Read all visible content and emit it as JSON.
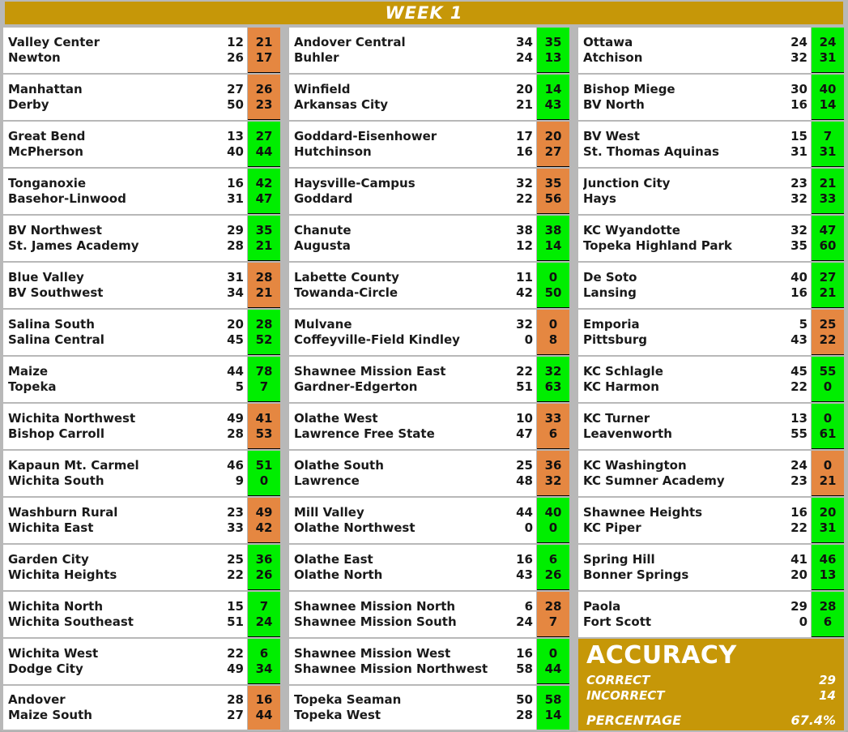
{
  "header": {
    "title": "WEEK 1"
  },
  "colors": {
    "header_gold": "#c69708",
    "correct_green": "#00ee00",
    "incorrect_orange": "#e58741",
    "page_background": "#b8b8b8",
    "row_background": "#ffffff"
  },
  "columns": [
    {
      "id": "column-1",
      "games": [
        {
          "away": "Valley Center",
          "away_score": "12",
          "home": "Newton",
          "home_score": "26",
          "pred_away": "21",
          "pred_home": "17",
          "result": "incorrect"
        },
        {
          "away": "Manhattan",
          "away_score": "27",
          "home": "Derby",
          "home_score": "50",
          "pred_away": "26",
          "pred_home": "23",
          "result": "incorrect"
        },
        {
          "away": "Great Bend",
          "away_score": "13",
          "home": "McPherson",
          "home_score": "40",
          "pred_away": "27",
          "pred_home": "44",
          "result": "correct"
        },
        {
          "away": "Tonganoxie",
          "away_score": "16",
          "home": "Basehor-Linwood",
          "home_score": "31",
          "pred_away": "42",
          "pred_home": "47",
          "result": "correct"
        },
        {
          "away": "BV Northwest",
          "away_score": "29",
          "home": "St. James Academy",
          "home_score": "28",
          "pred_away": "35",
          "pred_home": "21",
          "result": "correct"
        },
        {
          "away": "Blue Valley",
          "away_score": "31",
          "home": "BV Southwest",
          "home_score": "34",
          "pred_away": "28",
          "pred_home": "21",
          "result": "incorrect"
        },
        {
          "away": "Salina South",
          "away_score": "20",
          "home": "Salina Central",
          "home_score": "45",
          "pred_away": "28",
          "pred_home": "52",
          "result": "correct"
        },
        {
          "away": "Maize",
          "away_score": "44",
          "home": "Topeka",
          "home_score": "5",
          "pred_away": "78",
          "pred_home": "7",
          "result": "correct"
        },
        {
          "away": "Wichita Northwest",
          "away_score": "49",
          "home": "Bishop Carroll",
          "home_score": "28",
          "pred_away": "41",
          "pred_home": "53",
          "result": "incorrect"
        },
        {
          "away": "Kapaun Mt. Carmel",
          "away_score": "46",
          "home": "Wichita South",
          "home_score": "9",
          "pred_away": "51",
          "pred_home": "0",
          "result": "correct"
        },
        {
          "away": "Washburn Rural",
          "away_score": "23",
          "home": "Wichita East",
          "home_score": "33",
          "pred_away": "49",
          "pred_home": "42",
          "result": "incorrect"
        },
        {
          "away": "Garden City",
          "away_score": "25",
          "home": "Wichita Heights",
          "home_score": "22",
          "pred_away": "36",
          "pred_home": "26",
          "result": "correct"
        },
        {
          "away": "Wichita North",
          "away_score": "15",
          "home": "Wichita Southeast",
          "home_score": "51",
          "pred_away": "7",
          "pred_home": "24",
          "result": "correct"
        },
        {
          "away": "Wichita West",
          "away_score": "22",
          "home": "Dodge City",
          "home_score": "49",
          "pred_away": "6",
          "pred_home": "34",
          "result": "correct"
        },
        {
          "away": "Andover",
          "away_score": "28",
          "home": "Maize South",
          "home_score": "27",
          "pred_away": "16",
          "pred_home": "44",
          "result": "incorrect"
        }
      ]
    },
    {
      "id": "column-2",
      "games": [
        {
          "away": "Andover Central",
          "away_score": "34",
          "home": "Buhler",
          "home_score": "24",
          "pred_away": "35",
          "pred_home": "13",
          "result": "correct"
        },
        {
          "away": "Winfield",
          "away_score": "20",
          "home": "Arkansas City",
          "home_score": "21",
          "pred_away": "14",
          "pred_home": "43",
          "result": "correct"
        },
        {
          "away": "Goddard-Eisenhower",
          "away_score": "17",
          "home": "Hutchinson",
          "home_score": "16",
          "pred_away": "20",
          "pred_home": "27",
          "result": "incorrect"
        },
        {
          "away": "Haysville-Campus",
          "away_score": "32",
          "home": "Goddard",
          "home_score": "22",
          "pred_away": "35",
          "pred_home": "56",
          "result": "incorrect"
        },
        {
          "away": "Chanute",
          "away_score": "38",
          "home": "Augusta",
          "home_score": "12",
          "pred_away": "38",
          "pred_home": "14",
          "result": "correct"
        },
        {
          "away": "Labette County",
          "away_score": "11",
          "home": "Towanda-Circle",
          "home_score": "42",
          "pred_away": "0",
          "pred_home": "50",
          "result": "correct"
        },
        {
          "away": "Mulvane",
          "away_score": "32",
          "home": "Coffeyville-Field Kindley",
          "home_score": "0",
          "pred_away": "0",
          "pred_home": "8",
          "result": "incorrect"
        },
        {
          "away": "Shawnee Mission East",
          "away_score": "22",
          "home": "Gardner-Edgerton",
          "home_score": "51",
          "pred_away": "32",
          "pred_home": "63",
          "result": "correct"
        },
        {
          "away": "Olathe West",
          "away_score": "10",
          "home": "Lawrence Free State",
          "home_score": "47",
          "pred_away": "33",
          "pred_home": "6",
          "result": "incorrect"
        },
        {
          "away": "Olathe South",
          "away_score": "25",
          "home": "Lawrence",
          "home_score": "48",
          "pred_away": "36",
          "pred_home": "32",
          "result": "incorrect"
        },
        {
          "away": "Mill Valley",
          "away_score": "44",
          "home": "Olathe Northwest",
          "home_score": "0",
          "pred_away": "40",
          "pred_home": "0",
          "result": "correct"
        },
        {
          "away": "Olathe East",
          "away_score": "16",
          "home": "Olathe North",
          "home_score": "43",
          "pred_away": "6",
          "pred_home": "26",
          "result": "correct"
        },
        {
          "away": "Shawnee Mission North",
          "away_score": "6",
          "home": "Shawnee Mission South",
          "home_score": "24",
          "pred_away": "28",
          "pred_home": "7",
          "result": "incorrect"
        },
        {
          "away": "Shawnee Mission West",
          "away_score": "16",
          "home": "Shawnee Mission Northwest",
          "home_score": "58",
          "pred_away": "0",
          "pred_home": "44",
          "result": "correct"
        },
        {
          "away": "Topeka Seaman",
          "away_score": "50",
          "home": "Topeka West",
          "home_score": "28",
          "pred_away": "58",
          "pred_home": "14",
          "result": "correct"
        }
      ]
    },
    {
      "id": "column-3",
      "games": [
        {
          "away": "Ottawa",
          "away_score": "24",
          "home": "Atchison",
          "home_score": "32",
          "pred_away": "24",
          "pred_home": "31",
          "result": "correct"
        },
        {
          "away": "Bishop Miege",
          "away_score": "30",
          "home": "BV North",
          "home_score": "16",
          "pred_away": "40",
          "pred_home": "14",
          "result": "correct"
        },
        {
          "away": "BV West",
          "away_score": "15",
          "home": "St. Thomas Aquinas",
          "home_score": "31",
          "pred_away": "7",
          "pred_home": "31",
          "result": "correct"
        },
        {
          "away": "Junction City",
          "away_score": "23",
          "home": "Hays",
          "home_score": "32",
          "pred_away": "21",
          "pred_home": "33",
          "result": "correct"
        },
        {
          "away": "KC Wyandotte",
          "away_score": "32",
          "home": "Topeka Highland Park",
          "home_score": "35",
          "pred_away": "47",
          "pred_home": "60",
          "result": "correct"
        },
        {
          "away": "De Soto",
          "away_score": "40",
          "home": "Lansing",
          "home_score": "16",
          "pred_away": "27",
          "pred_home": "21",
          "result": "correct"
        },
        {
          "away": "Emporia",
          "away_score": "5",
          "home": "Pittsburg",
          "home_score": "43",
          "pred_away": "25",
          "pred_home": "22",
          "result": "incorrect"
        },
        {
          "away": "KC Schlagle",
          "away_score": "45",
          "home": "KC Harmon",
          "home_score": "22",
          "pred_away": "55",
          "pred_home": "0",
          "result": "correct"
        },
        {
          "away": "KC Turner",
          "away_score": "13",
          "home": "Leavenworth",
          "home_score": "55",
          "pred_away": "0",
          "pred_home": "61",
          "result": "correct"
        },
        {
          "away": "KC Washington",
          "away_score": "24",
          "home": "KC Sumner Academy",
          "home_score": "23",
          "pred_away": "0",
          "pred_home": "21",
          "result": "incorrect"
        },
        {
          "away": "Shawnee Heights",
          "away_score": "16",
          "home": "KC Piper",
          "home_score": "22",
          "pred_away": "20",
          "pred_home": "31",
          "result": "correct"
        },
        {
          "away": "Spring Hill",
          "away_score": "41",
          "home": "Bonner Springs",
          "home_score": "20",
          "pred_away": "46",
          "pred_home": "13",
          "result": "correct"
        },
        {
          "away": "Paola",
          "away_score": "29",
          "home": "Fort Scott",
          "home_score": "0",
          "pred_away": "28",
          "pred_home": "6",
          "result": "correct"
        }
      ]
    }
  ],
  "accuracy": {
    "title": "ACCURACY",
    "correct_label": "CORRECT",
    "correct_value": "29",
    "incorrect_label": "INCORRECT",
    "incorrect_value": "14",
    "percentage_label": "PERCENTAGE",
    "percentage_value": "67.4%"
  }
}
